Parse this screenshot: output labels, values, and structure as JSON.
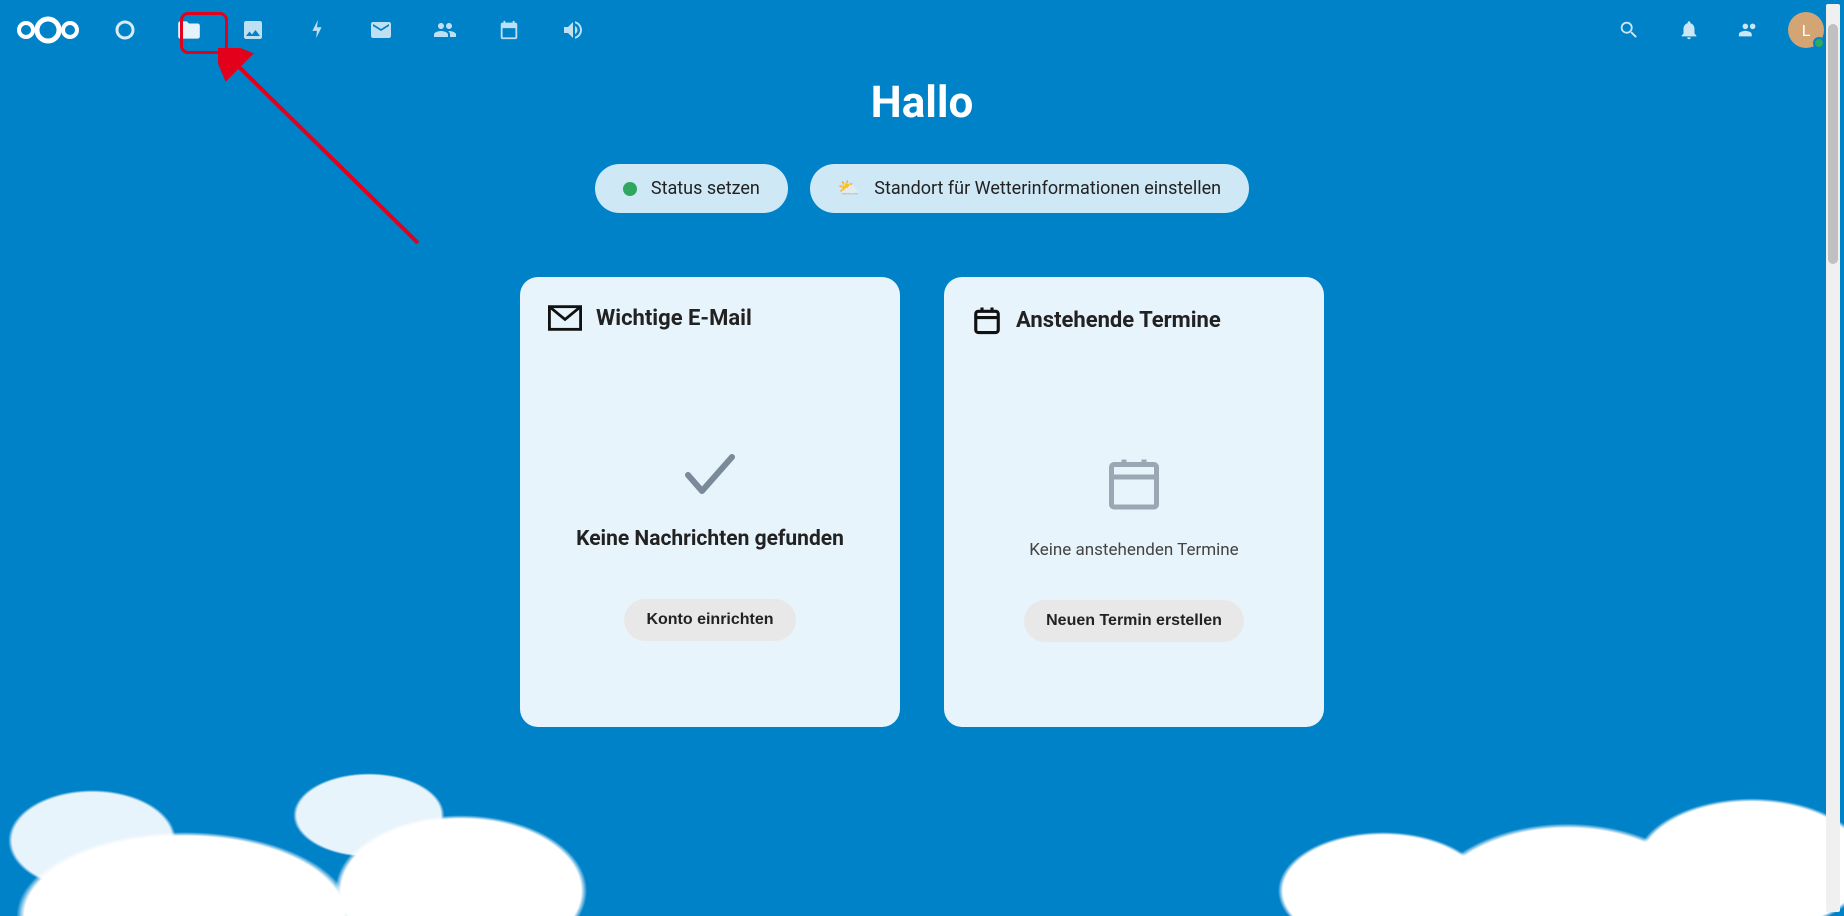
{
  "greeting": "Hallo",
  "pills": {
    "status": "Status setzen",
    "weather": "Standort für Wetterinformationen einstellen"
  },
  "widgets": {
    "mail": {
      "title": "Wichtige E-Mail",
      "empty_message": "Keine Nachrichten gefunden",
      "button": "Konto einrichten"
    },
    "calendar": {
      "title": "Anstehende Termine",
      "empty_message": "Keine anstehenden Termine",
      "button": "Neuen Termin erstellen"
    }
  },
  "avatar_initial": "L",
  "colors": {
    "primary": "#0082c9",
    "annotation": "#e2001a",
    "online": "#2fa75f"
  }
}
